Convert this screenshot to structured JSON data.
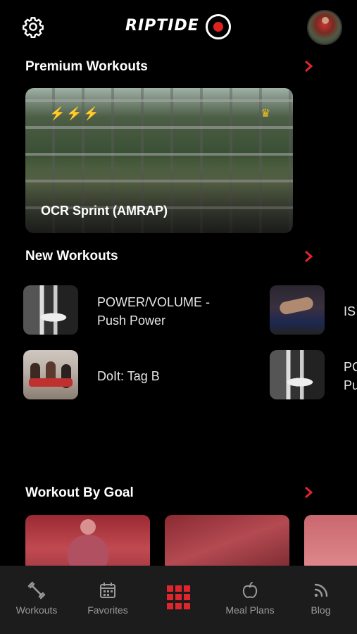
{
  "header": {
    "logo_text": "RIPTIDE",
    "icons": {
      "settings": "gear-icon",
      "avatar": "profile-avatar"
    }
  },
  "sections": {
    "premium": {
      "title": "Premium Workouts"
    },
    "new": {
      "title": "New Workouts"
    },
    "goal": {
      "title": "Workout By Goal"
    }
  },
  "premium_card": {
    "label": "OCR Sprint (AMRAP)",
    "bolts": [
      "⚡",
      "⚡",
      "⚡"
    ],
    "crown": "♛"
  },
  "new_workouts": [
    {
      "line1": "POWER/VOLUME -",
      "line2": "Push Power"
    },
    {
      "line1": "IS",
      "line2": ""
    },
    {
      "line1": "DoIt: Tag B",
      "line2": ""
    },
    {
      "line1": "PC",
      "line2": "Pu"
    }
  ],
  "bottom_nav": [
    {
      "label": "Workouts",
      "icon": "dumbbell-icon"
    },
    {
      "label": "Favorites",
      "icon": "calendar-icon"
    },
    {
      "label": "",
      "icon": "grid-menu-icon"
    },
    {
      "label": "Meal Plans",
      "icon": "apple-icon"
    },
    {
      "label": "Blog",
      "icon": "rss-icon"
    }
  ],
  "colors": {
    "accent": "#e0262d",
    "background": "#000000",
    "nav_bg": "#1c1c1c",
    "nav_text": "#9a9a9a"
  }
}
